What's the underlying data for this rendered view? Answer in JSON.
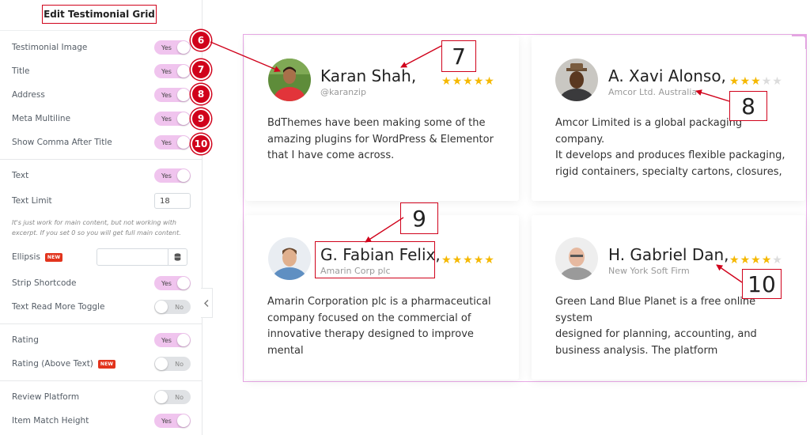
{
  "panel": {
    "title": "Edit Testimonial Grid",
    "note": "It's just work for main content, but not working with excerpt. If you set 0 so you will get full main content.",
    "collapse_icon": "chevron-left-icon",
    "controls": {
      "testimonial_image": {
        "label": "Testimonial Image",
        "value": "Yes"
      },
      "title": {
        "label": "Title",
        "value": "Yes"
      },
      "address": {
        "label": "Address",
        "value": "Yes"
      },
      "meta_multiline": {
        "label": "Meta Multiline",
        "value": "Yes"
      },
      "show_comma": {
        "label": "Show Comma After Title",
        "value": "Yes"
      },
      "text": {
        "label": "Text",
        "value": "Yes"
      },
      "text_limit": {
        "label": "Text Limit",
        "value": "18"
      },
      "ellipsis": {
        "label": "Ellipsis",
        "badge": "NEW",
        "value": ""
      },
      "strip_shortcode": {
        "label": "Strip Shortcode",
        "value": "Yes"
      },
      "read_more_toggle": {
        "label": "Text Read More Toggle",
        "value": "No"
      },
      "rating": {
        "label": "Rating",
        "value": "Yes"
      },
      "rating_above": {
        "label": "Rating (Above Text)",
        "badge": "NEW",
        "value": "No"
      },
      "review_platform": {
        "label": "Review Platform",
        "value": "No"
      },
      "item_match_height": {
        "label": "Item Match Height",
        "value": "Yes"
      }
    },
    "markers": [
      "6",
      "7",
      "8",
      "9",
      "10"
    ]
  },
  "testimonials": [
    {
      "name": "Karan Shah,",
      "address": "@karanzip",
      "rating": 5,
      "text": [
        "BdThemes have been making some of the",
        "amazing plugins for WordPress & Elementor",
        "that I have come across."
      ]
    },
    {
      "name": "A. Xavi Alonso,",
      "address": "Amcor Ltd. Australia",
      "rating": 3,
      "text": [
        "Amcor Limited is a global packaging company.",
        "It develops and produces flexible packaging,",
        "rigid containers, specialty cartons, closures,"
      ]
    },
    {
      "name": "G. Fabian Felix,",
      "address": "Amarin Corp plc",
      "rating": 5,
      "text": [
        "Amarin Corporation plc is a pharmaceutical",
        "company focused on the commercial of",
        "innovative therapy designed to improve mental"
      ]
    },
    {
      "name": "H. Gabriel Dan,",
      "address": "New York Soft Firm",
      "rating": 4,
      "text": [
        "Green Land Blue Planet is a free online system",
        "designed for planning, accounting, and",
        "business analysis. The platform"
      ]
    }
  ],
  "callouts": {
    "c7": "7",
    "c8": "8",
    "c9": "9",
    "c10": "10"
  },
  "colors": {
    "accent": "#d0021b",
    "toggle_on": "#f0c4ee",
    "star": "#f5b800",
    "preview_border": "#e8a8e6"
  }
}
